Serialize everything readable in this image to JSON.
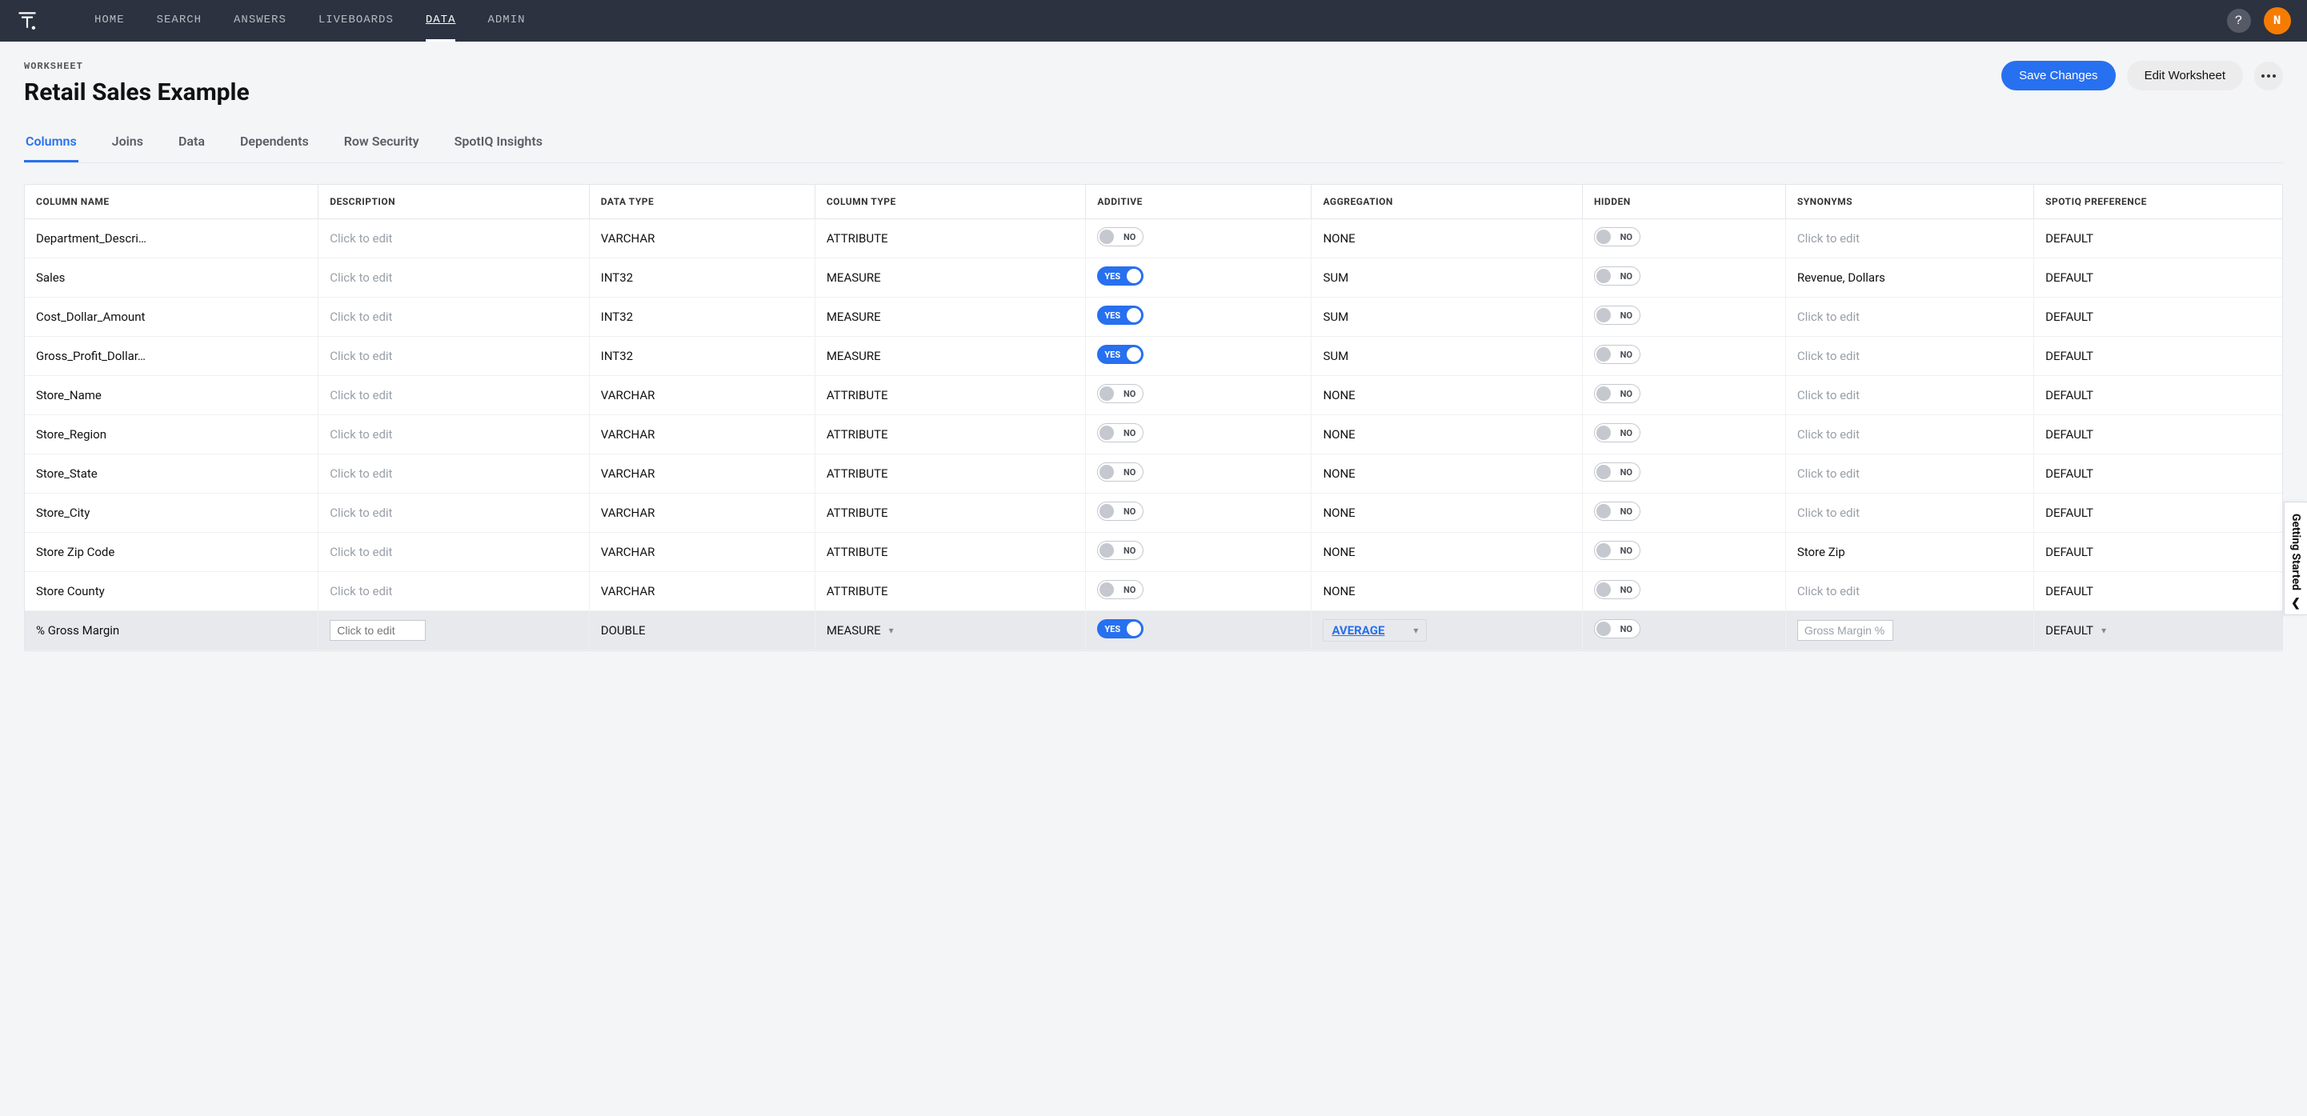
{
  "nav": {
    "items": [
      "HOME",
      "SEARCH",
      "ANSWERS",
      "LIVEBOARDS",
      "DATA",
      "ADMIN"
    ],
    "activeIndex": 4,
    "help": "?",
    "avatar": "N"
  },
  "page": {
    "crumb": "WORKSHEET",
    "title": "Retail Sales Example",
    "save": "Save Changes",
    "edit": "Edit Worksheet"
  },
  "tabs": {
    "items": [
      "Columns",
      "Joins",
      "Data",
      "Dependents",
      "Row Security",
      "SpotIQ Insights"
    ],
    "activeIndex": 0
  },
  "table": {
    "headers": [
      "COLUMN NAME",
      "DESCRIPTION",
      "DATA TYPE",
      "COLUMN TYPE",
      "ADDITIVE",
      "AGGREGATION",
      "HIDDEN",
      "SYNONYMS",
      "SPOTIQ PREFERENCE"
    ],
    "clickToEdit": "Click to edit",
    "yes": "YES",
    "no": "NO",
    "rows": [
      {
        "name": "Department_Descri…",
        "desc": null,
        "dtype": "VARCHAR",
        "ctype": "ATTRIBUTE",
        "additive": false,
        "agg": "NONE",
        "hidden": false,
        "syn": null,
        "spot": "DEFAULT"
      },
      {
        "name": "Sales",
        "desc": null,
        "dtype": "INT32",
        "ctype": "MEASURE",
        "additive": true,
        "agg": "SUM",
        "hidden": false,
        "syn": "Revenue, Dollars",
        "spot": "DEFAULT"
      },
      {
        "name": "Cost_Dollar_Amount",
        "desc": null,
        "dtype": "INT32",
        "ctype": "MEASURE",
        "additive": true,
        "agg": "SUM",
        "hidden": false,
        "syn": null,
        "spot": "DEFAULT"
      },
      {
        "name": "Gross_Profit_Dollar…",
        "desc": null,
        "dtype": "INT32",
        "ctype": "MEASURE",
        "additive": true,
        "agg": "SUM",
        "hidden": false,
        "syn": null,
        "spot": "DEFAULT"
      },
      {
        "name": "Store_Name",
        "desc": null,
        "dtype": "VARCHAR",
        "ctype": "ATTRIBUTE",
        "additive": false,
        "agg": "NONE",
        "hidden": false,
        "syn": null,
        "spot": "DEFAULT"
      },
      {
        "name": "Store_Region",
        "desc": null,
        "dtype": "VARCHAR",
        "ctype": "ATTRIBUTE",
        "additive": false,
        "agg": "NONE",
        "hidden": false,
        "syn": null,
        "spot": "DEFAULT"
      },
      {
        "name": "Store_State",
        "desc": null,
        "dtype": "VARCHAR",
        "ctype": "ATTRIBUTE",
        "additive": false,
        "agg": "NONE",
        "hidden": false,
        "syn": null,
        "spot": "DEFAULT"
      },
      {
        "name": "Store_City",
        "desc": null,
        "dtype": "VARCHAR",
        "ctype": "ATTRIBUTE",
        "additive": false,
        "agg": "NONE",
        "hidden": false,
        "syn": null,
        "spot": "DEFAULT"
      },
      {
        "name": "Store Zip Code",
        "desc": null,
        "dtype": "VARCHAR",
        "ctype": "ATTRIBUTE",
        "additive": false,
        "agg": "NONE",
        "hidden": false,
        "syn": "Store Zip",
        "spot": "DEFAULT"
      },
      {
        "name": "Store County",
        "desc": null,
        "dtype": "VARCHAR",
        "ctype": "ATTRIBUTE",
        "additive": false,
        "agg": "NONE",
        "hidden": false,
        "syn": null,
        "spot": "DEFAULT"
      },
      {
        "name": "% Gross Margin",
        "desc": null,
        "dtype": "DOUBLE",
        "ctype": "MEASURE",
        "additive": true,
        "agg": "AVERAGE",
        "hidden": false,
        "syn": "Gross Margin %",
        "spot": "DEFAULT",
        "selected": true
      }
    ]
  },
  "gettingStarted": "Getting Started"
}
